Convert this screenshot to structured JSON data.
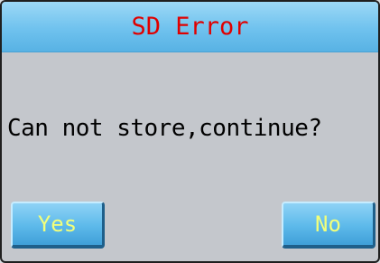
{
  "dialog": {
    "title": "SD Error",
    "message": "Can not store,continue?",
    "buttons": {
      "yes_label": "Yes",
      "no_label": "No"
    }
  },
  "colors": {
    "title_text": "#e00000",
    "title_bar": "#6fc2ee",
    "dialog_background": "#c4c7cc",
    "button_background": "#5db9ea",
    "button_text": "#f2ff7a"
  }
}
